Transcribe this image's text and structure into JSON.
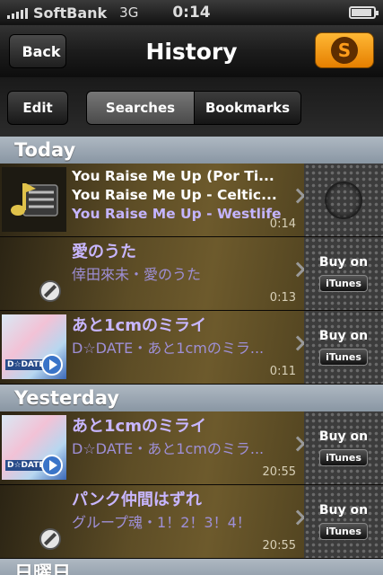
{
  "status_bar": {
    "carrier": "SoftBank",
    "network": "3G",
    "time": "0:14",
    "battery_level": 0.9
  },
  "nav": {
    "back_label": "Back",
    "title": "History",
    "logo_icon": "soundhound-icon"
  },
  "toolbar": {
    "edit_label": "Edit",
    "segments": [
      {
        "label": "Searches",
        "selected": true
      },
      {
        "label": "Bookmarks",
        "selected": false
      }
    ]
  },
  "sections": [
    {
      "header": "Today",
      "rows": [
        {
          "type": "multiple",
          "lines": [
            "You Raise Me Up (Por Ti...",
            "You Raise Me Up - Celtic...",
            "You Raise Me Up - Westlife"
          ],
          "time": "0:14",
          "thumbnail": "music-note-list-icon",
          "action": "loading"
        },
        {
          "type": "single",
          "title": "愛のうた",
          "subtitle": "倖田來未・愛のうた",
          "time": "0:13",
          "thumbnail": "no-preview-icon",
          "buy_label": "Buy on",
          "store_label": "iTunes"
        },
        {
          "type": "single",
          "title": "あと1cmのミライ",
          "subtitle": "D☆DATE・あと1cmのミラ...",
          "time": "0:11",
          "thumbnail": "album-art",
          "album_text": "D☆DATE",
          "buy_label": "Buy on",
          "store_label": "iTunes"
        }
      ]
    },
    {
      "header": "Yesterday",
      "rows": [
        {
          "type": "single",
          "title": "あと1cmのミライ",
          "subtitle": "D☆DATE・あと1cmのミラ...",
          "time": "20:55",
          "thumbnail": "album-art",
          "album_text": "D☆DATE",
          "buy_label": "Buy on",
          "store_label": "iTunes"
        },
        {
          "type": "single",
          "title": "パンク仲間はずれ",
          "subtitle": "グループ魂・1！2！3！4！",
          "time": "20:55",
          "thumbnail": "no-preview-icon",
          "buy_label": "Buy on",
          "store_label": "iTunes"
        }
      ]
    },
    {
      "header": "日曜日",
      "rows": []
    }
  ]
}
